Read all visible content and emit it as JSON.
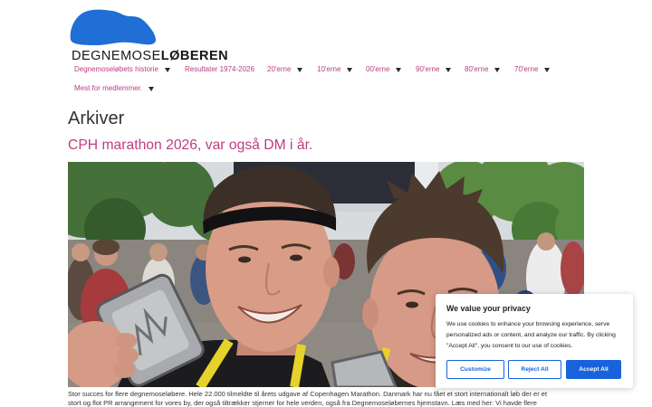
{
  "colors": {
    "page_background": "#ffffff",
    "logo_blue": "#1f6fd6",
    "link_magenta": "#b93d80",
    "post_title_magenta": "#c03c83",
    "heading_text": "#333333",
    "cookie_accent": "#1863dc"
  },
  "site": {
    "logo_word_1": "DEGNEMOSE",
    "logo_word_2": "LØBEREN"
  },
  "nav": {
    "items": [
      {
        "label": "Degnemoseløbets historie",
        "has_submenu": true
      },
      {
        "label": "Resultater 1974-2026",
        "has_submenu": false
      },
      {
        "label": "20'erne",
        "has_submenu": true
      },
      {
        "label": "10'erne",
        "has_submenu": true
      },
      {
        "label": "00'erne",
        "has_submenu": true
      },
      {
        "label": "90'erne",
        "has_submenu": true
      },
      {
        "label": "80'erne",
        "has_submenu": true
      },
      {
        "label": "70'erne",
        "has_submenu": true
      },
      {
        "label": "Mest for medlemmer.",
        "has_submenu": true
      }
    ]
  },
  "archive": {
    "title": "Arkiver"
  },
  "post": {
    "title": "CPH marathon 2026, var også DM i år.",
    "excerpt_lines": [
      "Stor succes for flere degnemoseløbere. Hele 22.000 tilmeldte til årets udgave af Copenhagen Marathon. Danmark har nu fået et stort internationalt løb der er et",
      "stort og flot PR arrangement for vores by, der også tiltrækker stjerner for hele verden, også fra Degnemoseløbernes hjemstavn. Læs med her: Vi havde flere"
    ]
  },
  "cookie_banner": {
    "title": "We value your privacy",
    "description": "We use cookies to enhance your browsing experience, serve personalized ads or content, and analyze our traffic. By clicking \"Accept All\", you consent to our use of cookies.",
    "buttons": {
      "customize": "Customize",
      "reject": "Reject All",
      "accept": "Accept All"
    }
  },
  "icons": {
    "submenu_toggle": "chevron-down-icon",
    "logo_mark": "blue-blob-logo"
  }
}
